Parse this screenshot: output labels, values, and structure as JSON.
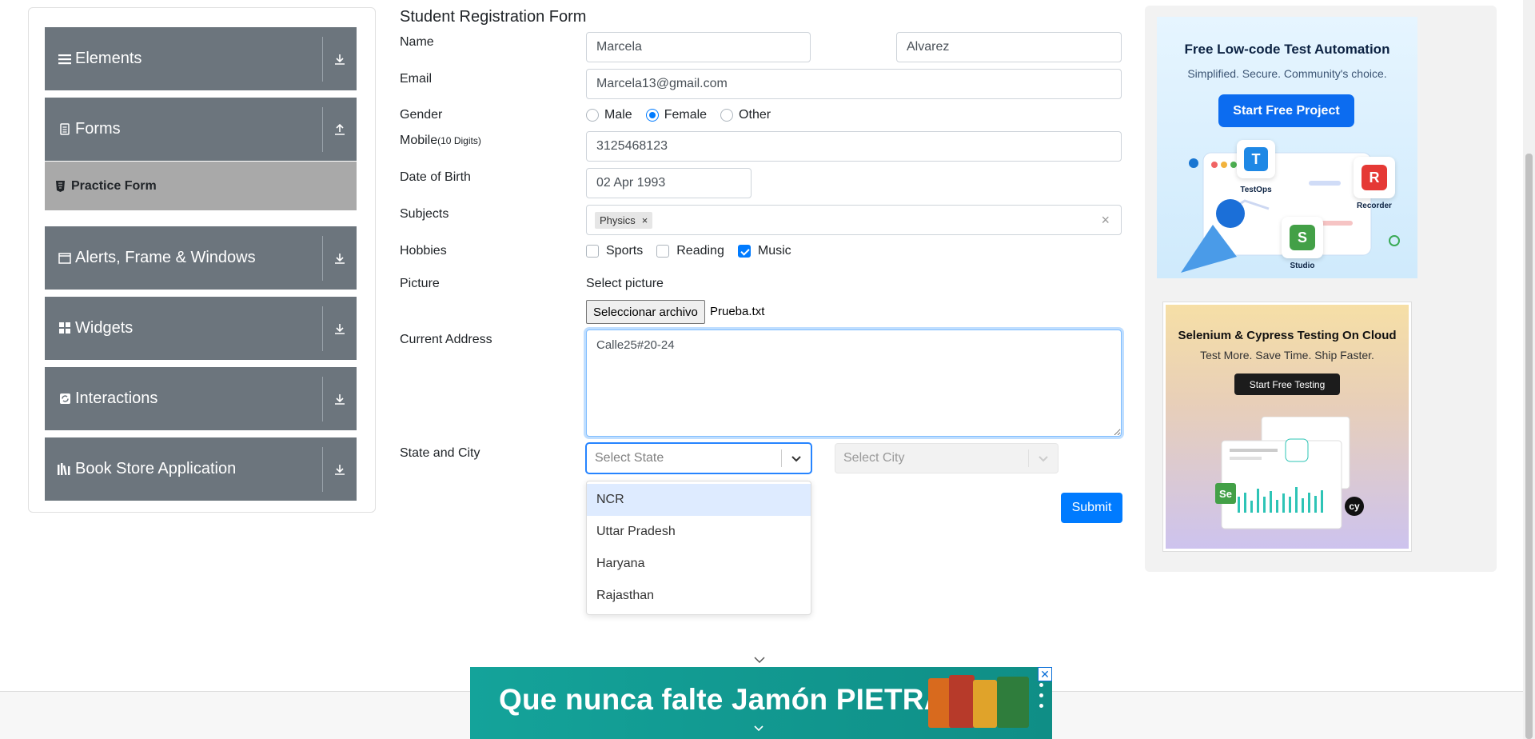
{
  "sidebar": {
    "groups": [
      {
        "label": "Elements",
        "icon": "menu-icon",
        "arrow": "download-icon"
      },
      {
        "label": "Forms",
        "icon": "document-icon",
        "arrow": "upload-icon"
      },
      {
        "label": "Alerts, Frame & Windows",
        "icon": "window-icon",
        "arrow": "download-icon"
      },
      {
        "label": "Widgets",
        "icon": "widgets-icon",
        "arrow": "download-icon"
      },
      {
        "label": "Interactions",
        "icon": "interactions-icon",
        "arrow": "download-icon"
      },
      {
        "label": "Book Store Application",
        "icon": "books-icon",
        "arrow": "download-icon"
      }
    ],
    "active_item": "Practice Form"
  },
  "form": {
    "title": "Student Registration Form",
    "labels": {
      "name": "Name",
      "email": "Email",
      "gender": "Gender",
      "mobile": "Mobile",
      "mobile_hint": "(10 Digits)",
      "dob": "Date of Birth",
      "subjects": "Subjects",
      "hobbies": "Hobbies",
      "picture": "Picture",
      "address": "Current Address",
      "state_city": "State and City"
    },
    "first_name": "Marcela",
    "last_name": "Alvarez",
    "email": "Marcela13@gmail.com",
    "gender_options": [
      "Male",
      "Female",
      "Other"
    ],
    "gender_selected": "Female",
    "mobile": "3125468123",
    "dob": "02 Apr 1993",
    "subjects": [
      "Physics"
    ],
    "subject_remove": "×",
    "subjects_clear": "×",
    "hobbies": [
      {
        "label": "Sports",
        "checked": false
      },
      {
        "label": "Reading",
        "checked": false
      },
      {
        "label": "Music",
        "checked": true
      }
    ],
    "picture_caption": "Select picture",
    "file_button": "Seleccionar archivo",
    "file_name": "Prueba.txt",
    "address": "Calle25#20-24",
    "state_placeholder": "Select State",
    "city_placeholder": "Select City",
    "state_options": [
      "NCR",
      "Uttar Pradesh",
      "Haryana",
      "Rajasthan"
    ],
    "state_highlighted": "NCR",
    "submit": "Submit"
  },
  "ads": {
    "top": {
      "title": "Free Low-code Test Automation",
      "subtitle": "Simplified. Secure. Community's choice.",
      "button": "Start Free Project",
      "tags": [
        "TestOps",
        "Recorder",
        "Studio"
      ],
      "tag_letters": [
        "T",
        "R",
        "S"
      ]
    },
    "middle": {
      "title": "Selenium & Cypress Testing On Cloud",
      "subtitle": "Test More. Save Time. Ship Faster.",
      "button": "Start Free Testing",
      "badges": [
        "Se",
        "cy"
      ]
    },
    "bottom": {
      "text": "Que nunca falte Jamón PIETRÁN",
      "close": "✕"
    }
  },
  "colors": {
    "sidebar_bg": "#6c757d",
    "sidebar_active": "#a9a9a9",
    "primary": "#007bff",
    "bottom_ad": "#14a39a"
  }
}
